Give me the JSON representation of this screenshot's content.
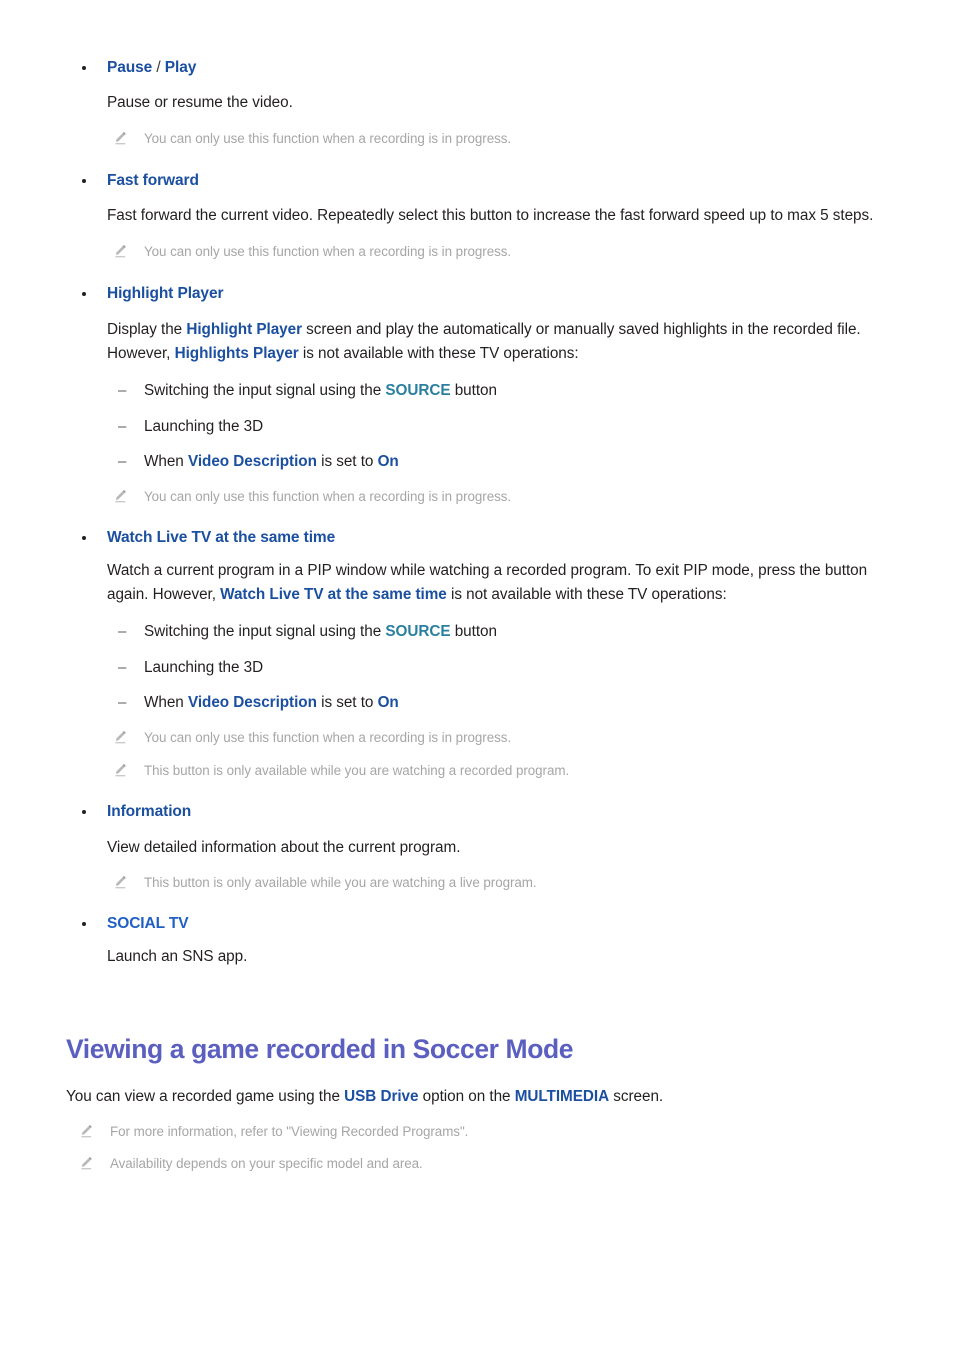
{
  "document": {
    "icons": {
      "note": "pencil-icon"
    },
    "colors": {
      "link_blue": "#1b4fa0",
      "link_teal": "#2a7fa0",
      "link_bright_blue": "#2060c4",
      "heading_periwinkle": "#5a5fc0",
      "body_text": "#231f20",
      "note_text": "#a6a6a6"
    },
    "bullets": [
      {
        "title_first": "Pause",
        "separator": " / ",
        "title_second": "Play",
        "body": "Pause or resume the video.",
        "note": "You can only use this function when a recording is in progress."
      },
      {
        "title": "Fast forward",
        "body": "Fast forward the current video. Repeatedly select this button to increase the fast forward speed up to max 5 steps.",
        "note": "You can only use this function when a recording is in progress."
      },
      {
        "title": "Highlight Player",
        "body_part1": "Display the ",
        "body_link1": "Highlight Player",
        "body_part2": " screen and play the automatically or manually saved highlights in the recorded file. However, ",
        "body_link2": "Highlights Player",
        "body_part3": " is not available with these TV operations:",
        "sub_items": [
          {
            "pre": "Switching the input signal using the ",
            "link": "SOURCE",
            "post": " button"
          },
          {
            "pre": "Launching the 3D",
            "link": "",
            "post": ""
          },
          {
            "pre": "When ",
            "link": "Video Description",
            "mid": " is set to ",
            "link2": "On",
            "post": ""
          }
        ],
        "note": "You can only use this function when a recording is in progress."
      },
      {
        "title": "Watch Live TV at the same time",
        "body_part1": "Watch a current program in a PIP window while watching a recorded program. To exit PIP mode, press the button again. However, ",
        "body_link1": "Watch Live TV at the same time",
        "body_part2": " is not available with these TV operations:",
        "sub_items": [
          {
            "pre": "Switching the input signal using the ",
            "link": "SOURCE",
            "post": " button"
          },
          {
            "pre": "Launching the 3D",
            "link": "",
            "post": ""
          },
          {
            "pre": "When ",
            "link": "Video Description",
            "mid": " is set to ",
            "link2": "On",
            "post": ""
          }
        ],
        "note1": "You can only use this function when a recording is in progress.",
        "note2": "This button is only available while you are watching a recorded program."
      },
      {
        "title": "Information",
        "body": "View detailed information about the current program.",
        "note": "This button is only available while you are watching a live program."
      },
      {
        "title": "SOCIAL TV",
        "body": "Launch an SNS app."
      }
    ],
    "section": {
      "heading": "Viewing a game recorded in Soccer Mode",
      "intro_part1": "You can view a recorded game using the ",
      "intro_link1": "USB Drive",
      "intro_part2": " option on the ",
      "intro_link2": "MULTIMEDIA",
      "intro_part3": " screen.",
      "note1": "For more information, refer to \"Viewing Recorded Programs\".",
      "note2": "Availability depends on your specific model and area."
    }
  }
}
